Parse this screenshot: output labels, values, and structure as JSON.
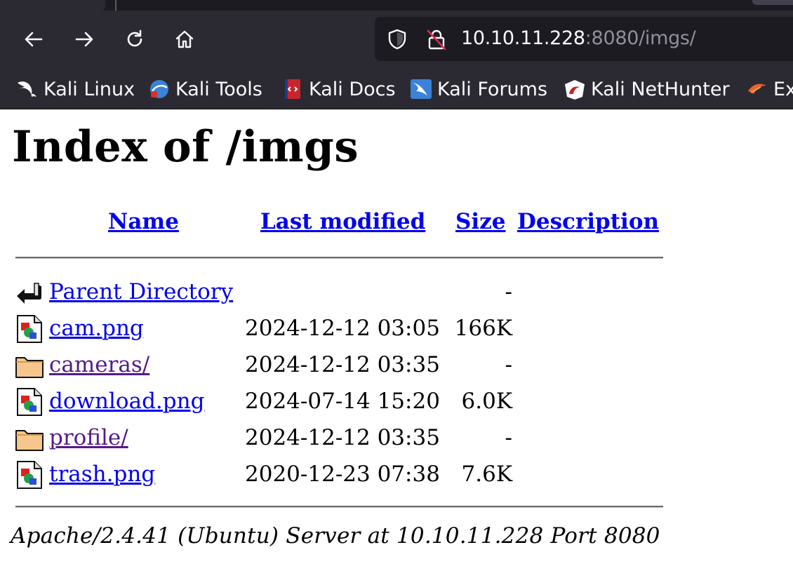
{
  "browser": {
    "url_host": "10.10.11.228",
    "url_path": ":8080/imgs/",
    "bookmarks": [
      {
        "label": "Kali Linux",
        "icon": "kali-dragon-icon"
      },
      {
        "label": "Kali Tools",
        "icon": "kali-tools-icon"
      },
      {
        "label": "Kali Docs",
        "icon": "kali-docs-icon"
      },
      {
        "label": "Kali Forums",
        "icon": "kali-forums-icon"
      },
      {
        "label": "Kali NetHunter",
        "icon": "kali-nethunter-icon"
      },
      {
        "label": "Ex",
        "icon": "exploit-db-icon"
      }
    ]
  },
  "page": {
    "title": "Index of /imgs",
    "columns": {
      "name": "Name",
      "last_modified": "Last modified",
      "size": "Size",
      "description": "Description"
    },
    "entries": [
      {
        "name": "Parent Directory",
        "date": "",
        "size": "-",
        "icon": "back-arrow-icon",
        "visited": false
      },
      {
        "name": "cam.png",
        "date": "2024-12-12 03:05",
        "size": "166K",
        "icon": "image-file-icon",
        "visited": false
      },
      {
        "name": "cameras/",
        "date": "2024-12-12 03:35",
        "size": "-",
        "icon": "folder-icon",
        "visited": true
      },
      {
        "name": "download.png",
        "date": "2024-07-14 15:20",
        "size": "6.0K",
        "icon": "image-file-icon",
        "visited": false
      },
      {
        "name": "profile/",
        "date": "2024-12-12 03:35",
        "size": "-",
        "icon": "folder-icon",
        "visited": true
      },
      {
        "name": "trash.png",
        "date": "2020-12-23 07:38",
        "size": "7.6K",
        "icon": "image-file-icon",
        "visited": false
      }
    ],
    "server_signature": "Apache/2.4.41 (Ubuntu) Server at 10.10.11.228 Port 8080"
  }
}
